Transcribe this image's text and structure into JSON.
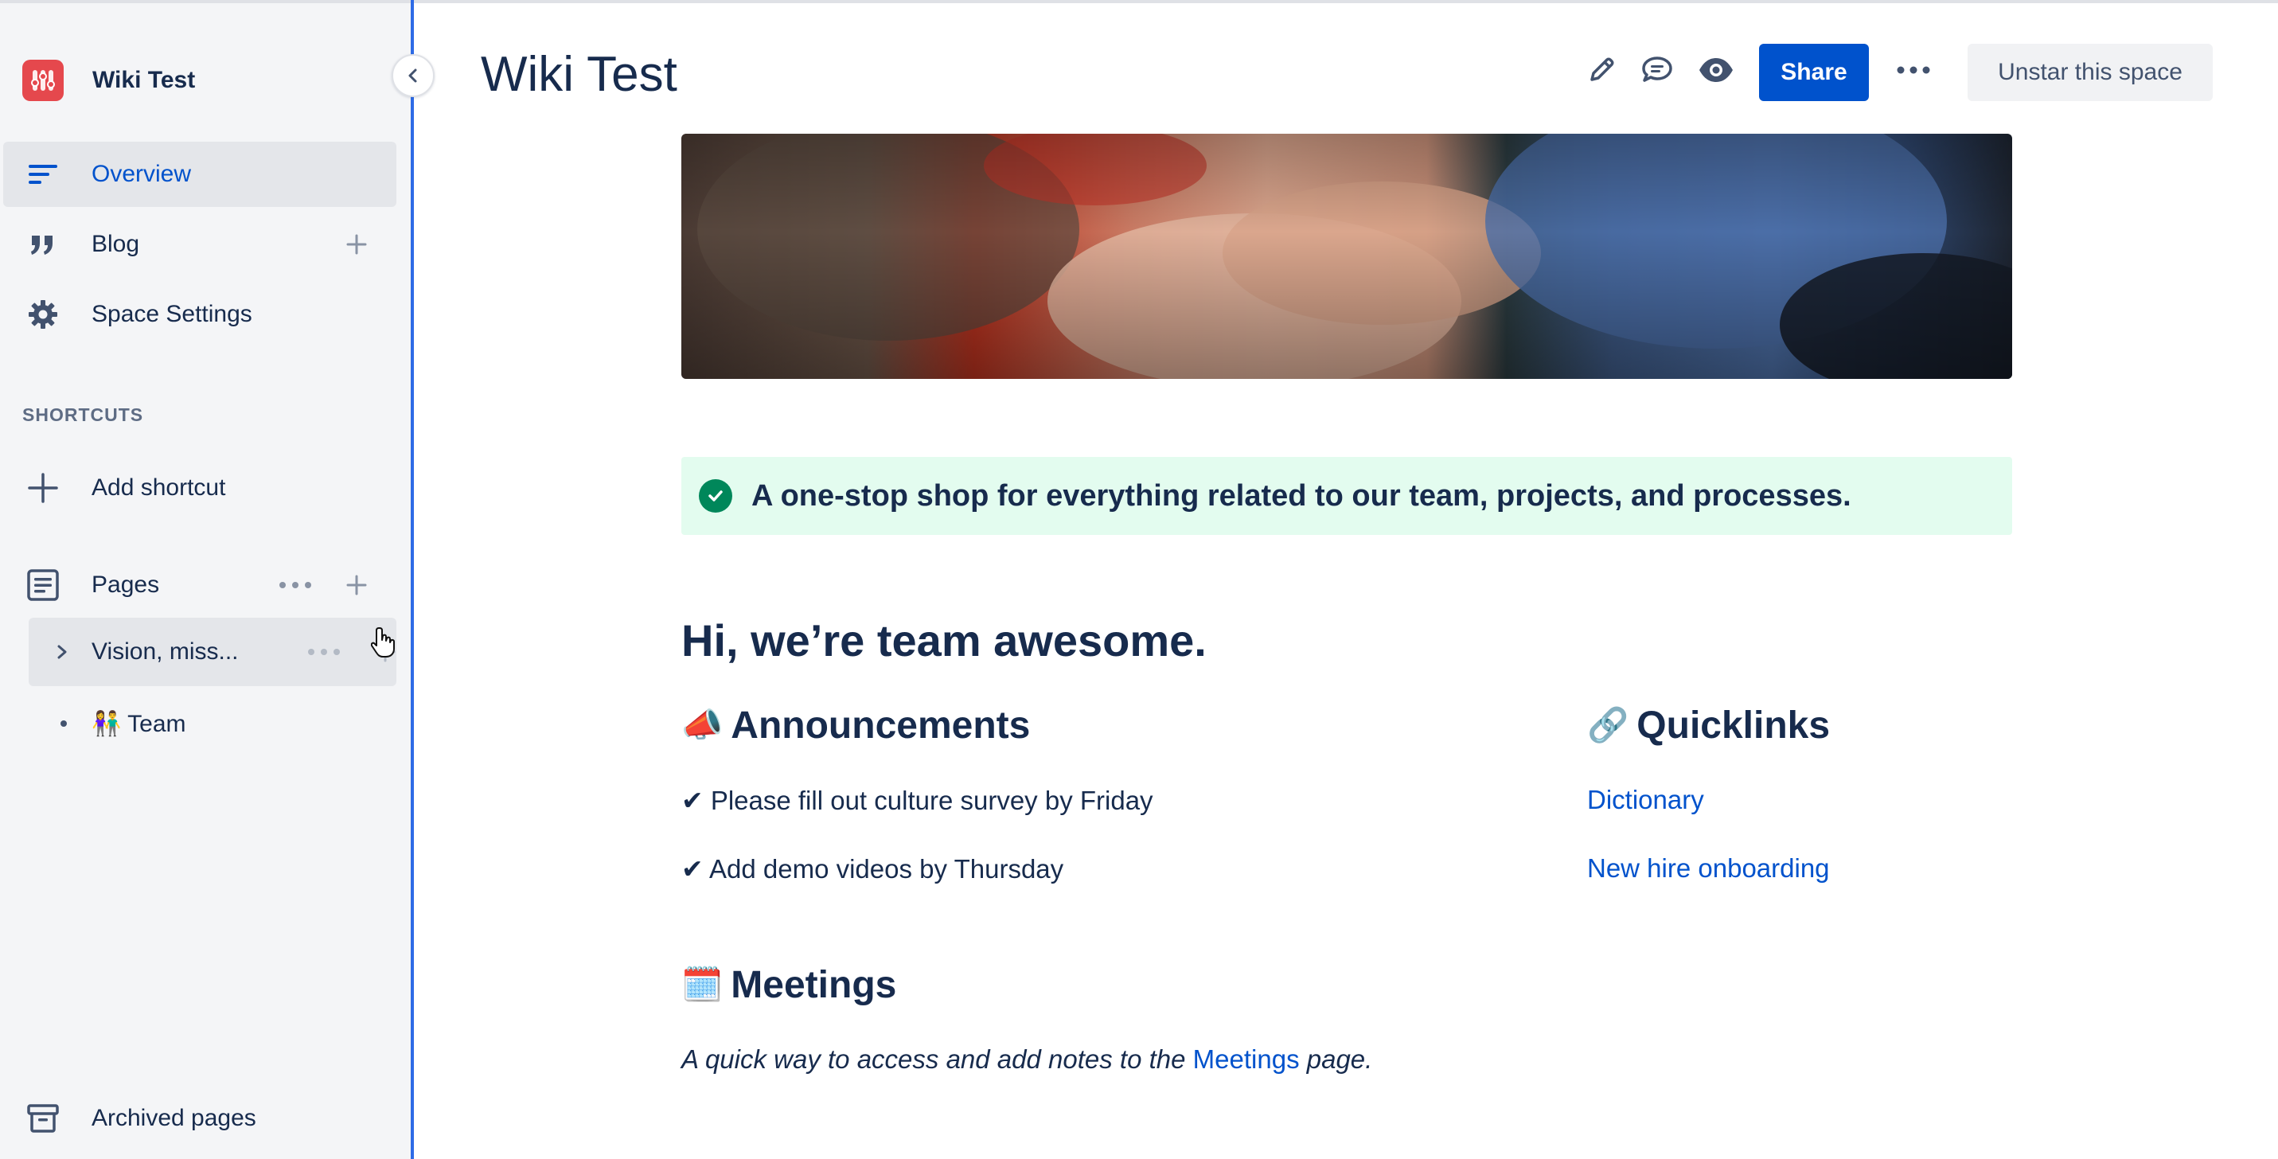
{
  "space": {
    "name": "Wiki Test"
  },
  "sidebar": {
    "nav": [
      {
        "label": "Overview",
        "icon": "overview-icon",
        "active": true
      },
      {
        "label": "Blog",
        "icon": "quote-icon"
      },
      {
        "label": "Space Settings",
        "icon": "gear-icon"
      }
    ],
    "shortcuts_heading": "SHORTCUTS",
    "add_shortcut": "Add shortcut",
    "pages_label": "Pages",
    "tree": [
      {
        "label": "Vision, miss...",
        "has_children": true
      },
      {
        "label": "Team",
        "emoji": "👫"
      }
    ],
    "archived": "Archived pages"
  },
  "header": {
    "title": "Wiki Test",
    "share_label": "Share",
    "unstar_label": "Unstar this space"
  },
  "content": {
    "panel_text": "A one-stop shop for everything related to our team, projects, and processes.",
    "heading": "Hi, we’re team awesome.",
    "announcements": {
      "emoji": "📣",
      "title": "Announcements",
      "items": [
        "✔ Please fill out culture survey by Friday",
        "✔ Add demo videos by Thursday"
      ]
    },
    "quicklinks": {
      "emoji": "🔗",
      "title": "Quicklinks",
      "links": [
        "Dictionary",
        "New hire onboarding"
      ]
    },
    "meetings": {
      "emoji": "🗓️",
      "title": "Meetings",
      "desc_before": "A quick way to access and add notes to the ",
      "desc_link": "Meetings",
      "desc_after": " page."
    }
  },
  "colors": {
    "accent": "#0052cc",
    "sidebar_bg": "#f4f5f7",
    "success_panel": "#e3fcef",
    "logo": "#e5484d"
  }
}
